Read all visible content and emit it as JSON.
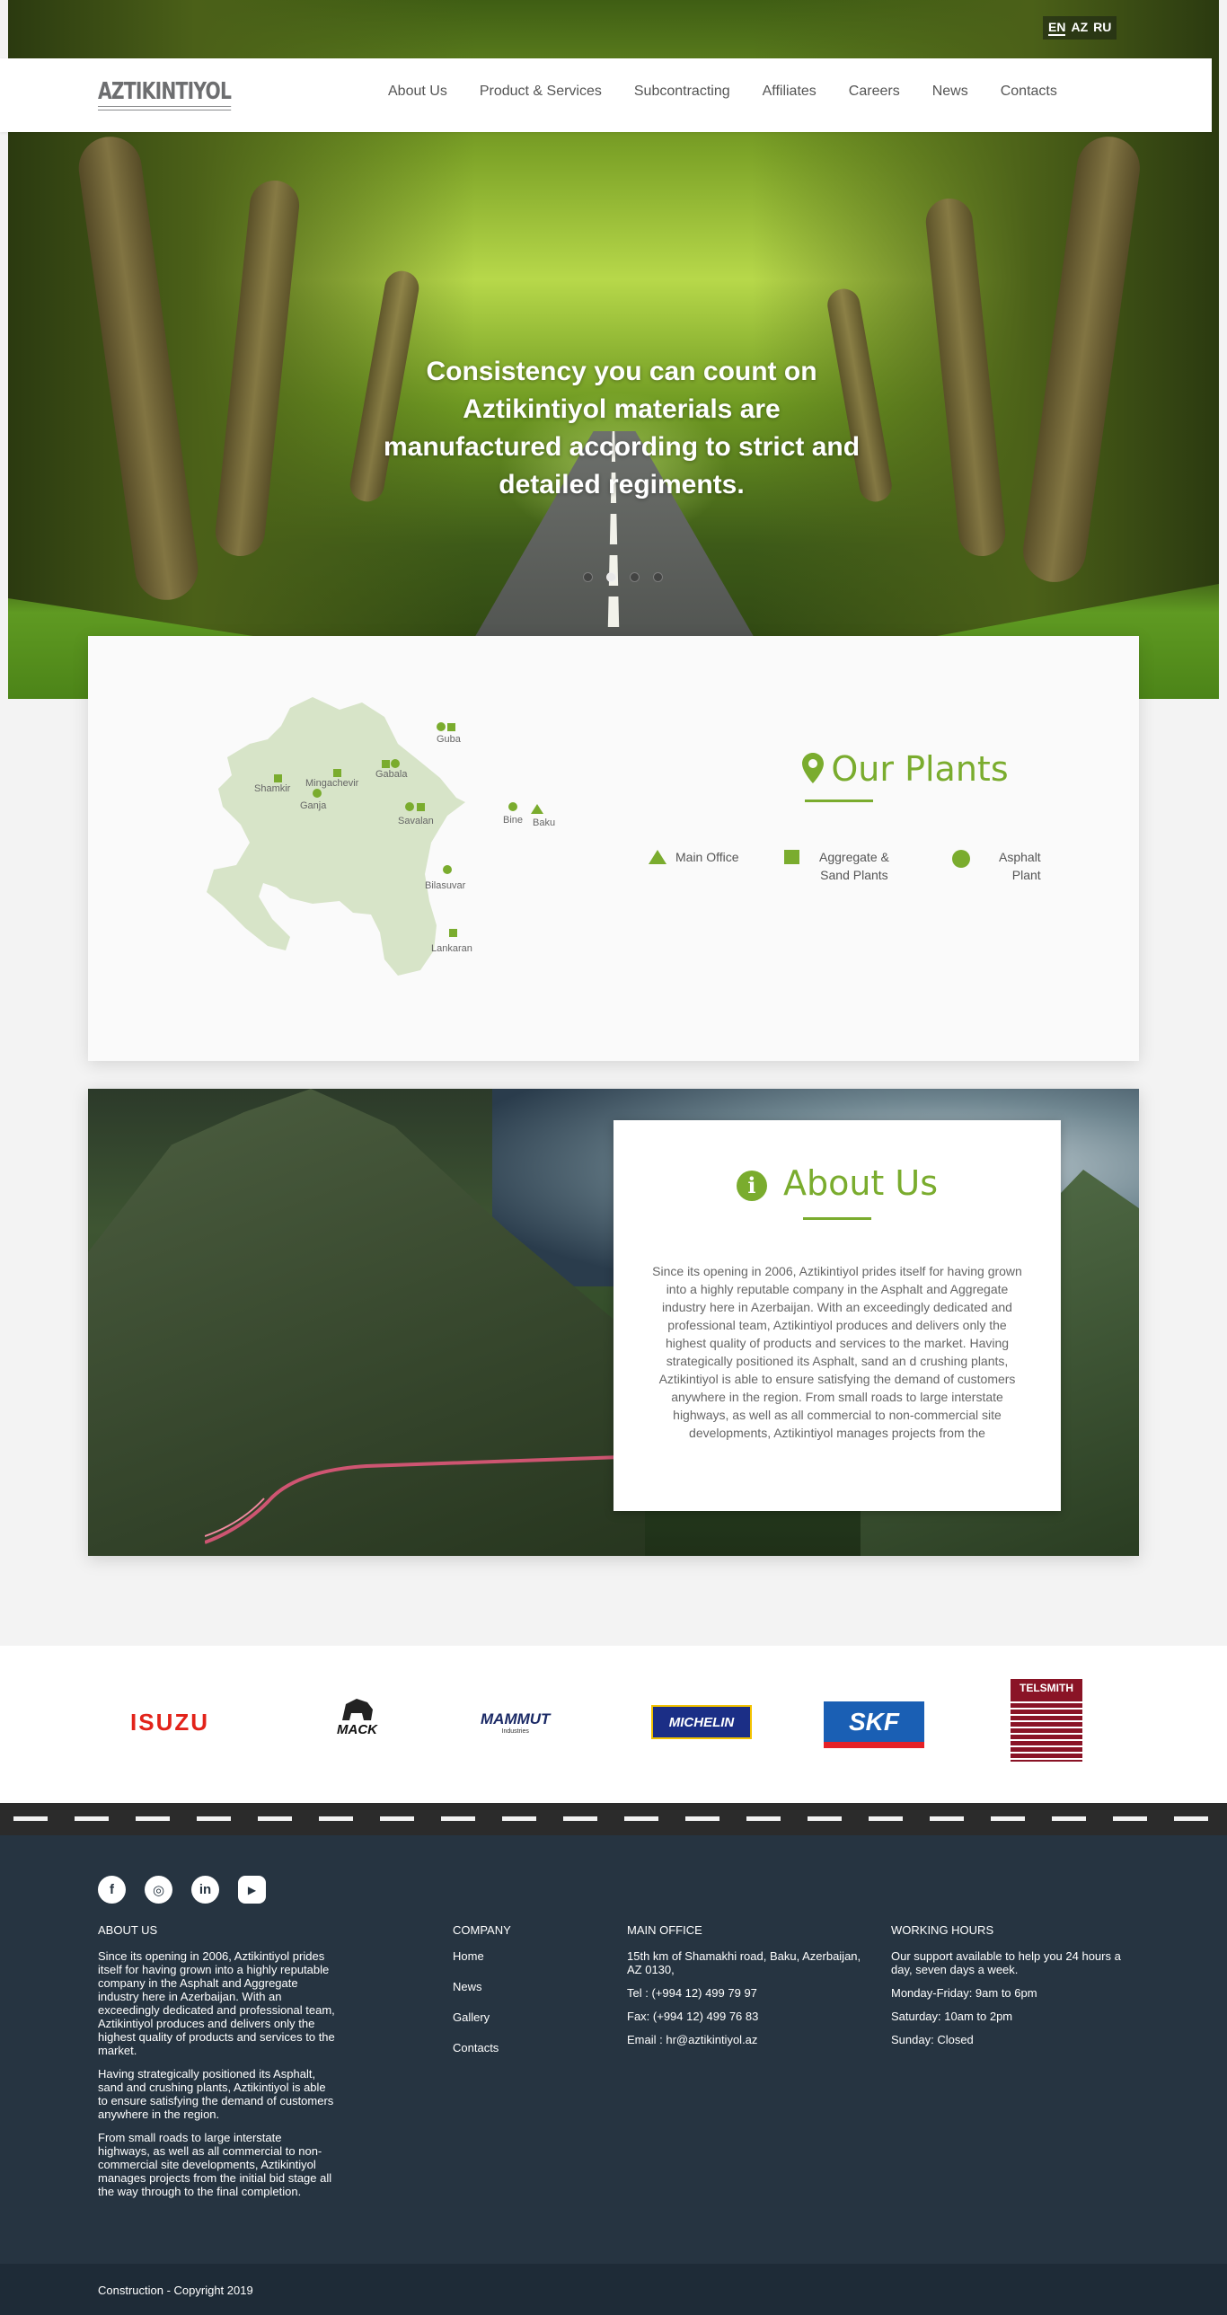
{
  "lang": [
    "EN",
    "AZ",
    "RU"
  ],
  "logo": "AZTIKINTIYOL",
  "nav": [
    "About Us",
    "Product & Services",
    "Subcontracting",
    "Affiliates",
    "Careers",
    "News",
    "Contacts"
  ],
  "hero": {
    "line1": "Consistency you can count on",
    "line2": "Aztikintiyol materials are",
    "line3": "manufactured according to strict and",
    "line4": "detailed regiments.",
    "slide_count": 4,
    "active_slide": 2
  },
  "plants": {
    "title": "Our Plants",
    "cities": [
      "Guba",
      "Shamkir",
      "Mingachevir",
      "Gabala",
      "Ganja",
      "Savalan",
      "Bine",
      "Baku",
      "Bilasuvar",
      "Lankaran"
    ],
    "legend": {
      "main_office": "Main Office",
      "aggregate_1": "Aggregate &",
      "aggregate_2": "Sand Plants",
      "asphalt_1": "Asphalt",
      "asphalt_2": "Plant"
    },
    "accent": "#7aac2e"
  },
  "about": {
    "title": "About Us",
    "text": "Since its opening in 2006, Aztikintiyol prides itself for having grown into a highly reputable company in the Asphalt and Aggregate industry here in Azerbaijan. With an exceedingly dedicated and professional team, Aztikintiyol produces and delivers only the highest quality of products and services to the market. Having strategically positioned its Asphalt, sand an d crushing plants, Aztikintiyol is able to ensure satisfying the demand of customers anywhere in the region. From small roads to large interstate highways, as well as all commercial to non-commercial site developments, Aztikintiyol manages projects from the"
  },
  "partners": {
    "isuzu": "ISUZU",
    "mack": "MACK",
    "mammut": "MAMMUT",
    "mammut_sub": "Industries",
    "michelin": "MICHELIN",
    "skf": "SKF",
    "telsmith": "TELSMITH"
  },
  "footer": {
    "social": [
      "f",
      "◎",
      "in",
      "▶"
    ],
    "about_heading": "ABOUT US",
    "about_p1": "Since its opening in 2006, Aztikintiyol prides itself for having grown into a highly reputable company in the Asphalt and Aggregate industry here in Azerbaijan. With an exceedingly dedicated and professional team, Aztikintiyol produces and delivers only the highest quality of products and services to the market.",
    "about_p2": "Having strategically positioned its Asphalt, sand and crushing plants, Aztikintiyol is able to ensure satisfying the demand of customers anywhere in the region.",
    "about_p3": "From small roads to large interstate highways, as well as all commercial to non-commercial site developments, Aztikintiyol manages projects from the initial bid stage all the way through to the final completion.",
    "company_heading": "COMPANY",
    "company_links": [
      "Home",
      "News",
      "Gallery",
      "Contacts"
    ],
    "office_heading": "MAIN OFFICE",
    "office_address": "15th km of Shamakhi road, Baku, Azerbaijan, AZ 0130,",
    "office_tel": "Tel : (+994 12) 499 79 97",
    "office_fax": "Fax: (+994 12) 499 76 83",
    "office_email": "Email : hr@aztikintiyol.az",
    "hours_heading": "WORKING HOURS",
    "hours_intro": "Our support available to help you 24 hours a day, seven days a week.",
    "hours_weekday": "Monday-Friday: 9am to 6pm",
    "hours_saturday": "Saturday: 10am to 2pm",
    "hours_sunday": "Sunday: Closed",
    "copyright": "Construction - Copyright 2019"
  }
}
